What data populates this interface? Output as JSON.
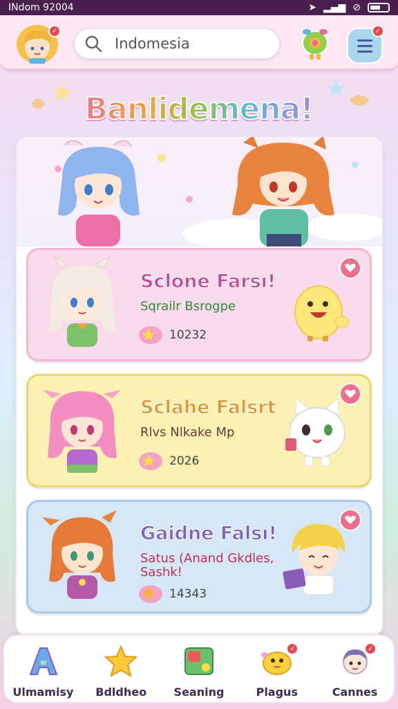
{
  "status_bar": {
    "carrier": "INdom 92004"
  },
  "search": {
    "value": "Indomesia"
  },
  "banner": {
    "title": "Banlidemena!"
  },
  "cards": [
    {
      "title": "Sclone Farsı!",
      "subtitle": "Sqrailr Bsrogpe",
      "count": "10232",
      "color": "pink"
    },
    {
      "title": "Sclahe Falsrt",
      "subtitle": "Rlvs Nlkake Mp",
      "count": "2026",
      "color": "yellow"
    },
    {
      "title": "Gaidne Falsı!",
      "subtitle": "Satus (Anand Gkdles, Sashk!",
      "count": "14343",
      "color": "blue"
    }
  ],
  "nav": [
    {
      "label": "Ulmamisy",
      "icon": "letter-a-icon"
    },
    {
      "label": "Bdldheo",
      "icon": "star-icon"
    },
    {
      "label": "Seaning",
      "icon": "puzzle-icon"
    },
    {
      "label": "Plagus",
      "icon": "chick-icon"
    },
    {
      "label": "Cannes",
      "icon": "avatar-icon"
    }
  ],
  "colors": {
    "accent_pink": "#f2b7d5",
    "accent_yellow": "#efd56e",
    "accent_blue": "#a8c9ea",
    "badge": "#e9484f"
  }
}
